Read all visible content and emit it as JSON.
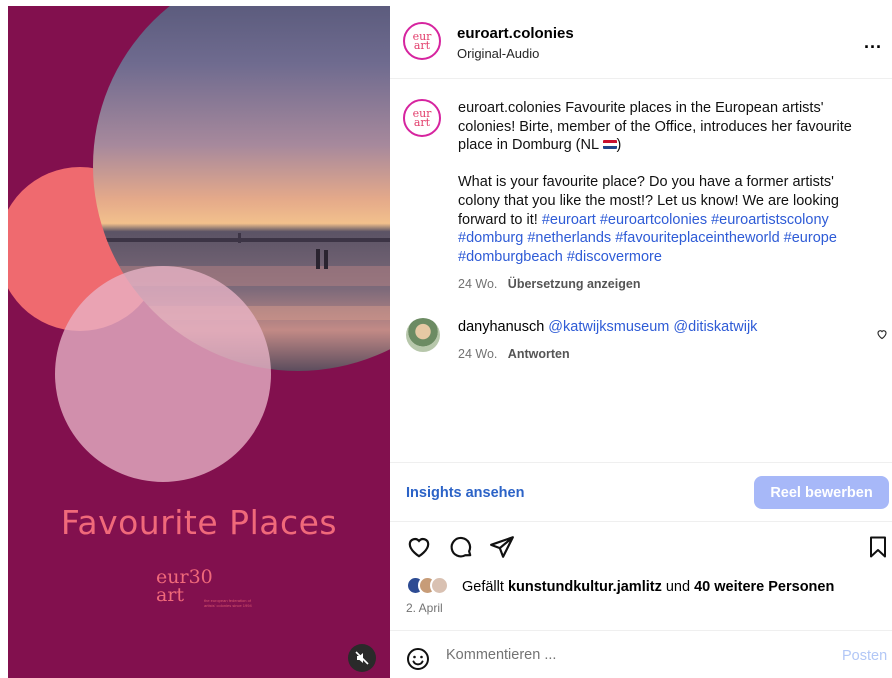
{
  "media": {
    "title": "Favourite Places",
    "logo_line1": "eur30",
    "logo_line2": "art",
    "logo_small": "the european federation of artists' colonies since 1994",
    "mute_icon": "speaker-muted-icon"
  },
  "header": {
    "username": "euroart.colonies",
    "audio": "Original-Audio",
    "more": "...",
    "avatar_line1": "eur",
    "avatar_line2": "art"
  },
  "caption": {
    "username": "euroart.colonies",
    "text1": "Favourite places in the European artists' colonies! Birte, member of the Office, introduces her favourite place in Domburg (NL",
    "text1_end": ")",
    "text2": "What is your favourite place? Do you have a former artists' colony that you like the most!? Let us know! We are looking forward to it!",
    "hashtags": [
      "#euroart",
      "#euroartcolonies",
      "#euroartistscolony",
      "#domburg",
      "#netherlands",
      "#favouriteplaceintheworld",
      "#europe",
      "#domburgbeach",
      "#discovermore"
    ],
    "time": "24 Wo.",
    "translate": "Übersetzung anzeigen"
  },
  "comment": {
    "username": "danyhanusch",
    "mention1": "@katwijksmuseum",
    "mention2": "@ditiskatwijk",
    "time": "24 Wo.",
    "reply": "Antworten"
  },
  "insights": {
    "link": "Insights ansehen",
    "promote": "Reel bewerben"
  },
  "likes": {
    "prefix": "Gefällt",
    "user": "kunstundkultur.jamlitz",
    "middle": "und",
    "others": "40 weitere Personen",
    "date": "2. April"
  },
  "comment_bar": {
    "placeholder": "Kommentieren ...",
    "post": "Posten"
  },
  "colors": {
    "media_bg": "#82104e",
    "accent_text": "#f0697a",
    "link_blue": "#2e5bd6",
    "promote_bg": "#a7b8f8"
  }
}
